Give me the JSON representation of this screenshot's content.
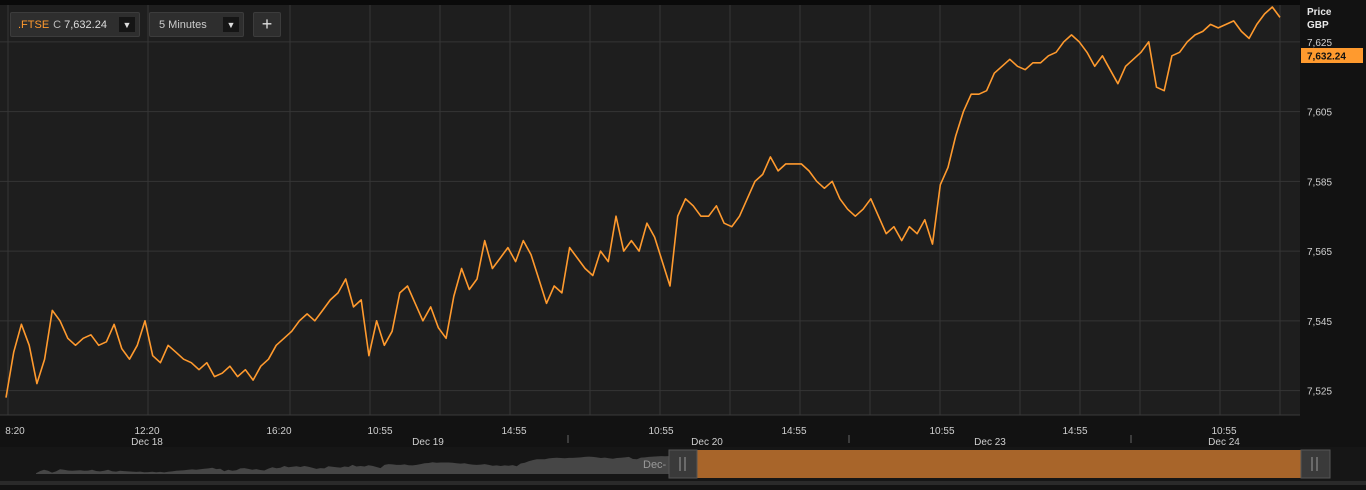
{
  "toolbar": {
    "symbol": ".FTSE",
    "close_prefix": "C",
    "close_value": "7,632.24",
    "interval": "5 Minutes",
    "add_label": "+"
  },
  "price_axis": {
    "label": "Price",
    "currency": "GBP",
    "current_value": "7,632.24"
  },
  "navigator": {
    "left_label": "Dec-"
  },
  "colors": {
    "line": "#ff9a2e",
    "background": "#1e1e1e",
    "grid": "#363636",
    "badge": "#ff9a2e",
    "navigator_fill": "#a8652a"
  },
  "chart_data": {
    "type": "line",
    "series": [
      {
        "values": [
          7523,
          7536,
          7544,
          7538,
          7527,
          7534,
          7548,
          7545,
          7540,
          7538,
          7540,
          7541,
          7538,
          7539,
          7544,
          7537,
          7534,
          7538,
          7545,
          7535,
          7533,
          7538,
          7536,
          7534,
          7533,
          7531,
          7533,
          7529,
          7530,
          7532,
          7529,
          7531,
          7528,
          7532,
          7534,
          7538,
          7540,
          7542,
          7545,
          7547,
          7545,
          7548,
          7551,
          7553,
          7557,
          7549,
          7551,
          7535,
          7545,
          7538,
          7542,
          7553,
          7555,
          7550,
          7545,
          7549,
          7543,
          7540,
          7552,
          7560,
          7554,
          7557,
          7568,
          7560,
          7563,
          7566,
          7562,
          7568,
          7564,
          7557,
          7550,
          7555,
          7553,
          7566,
          7563,
          7560,
          7558,
          7565,
          7562,
          7575,
          7565,
          7568,
          7565,
          7573,
          7569,
          7562,
          7555,
          7575,
          7580,
          7578,
          7575,
          7575,
          7578,
          7573,
          7572,
          7575,
          7580,
          7585,
          7587,
          7592,
          7588,
          7590,
          7590,
          7590,
          7588,
          7585,
          7583,
          7585,
          7580,
          7577,
          7575,
          7577,
          7580,
          7575,
          7570,
          7572,
          7568,
          7572,
          7570,
          7574,
          7567,
          7584,
          7589,
          7598,
          7605,
          7610,
          7610,
          7611,
          7616,
          7618,
          7620,
          7618,
          7617,
          7619,
          7619,
          7621,
          7622,
          7625,
          7627,
          7625,
          7622,
          7618,
          7621,
          7617,
          7613,
          7618,
          7620,
          7622,
          7625,
          7612,
          7611,
          7621,
          7622,
          7625,
          7627,
          7628,
          7630,
          7629,
          7630,
          7631,
          7628,
          7626,
          7630,
          7633,
          7635,
          7632
        ]
      }
    ],
    "ylim": [
      7518,
      7637
    ],
    "yticks": [
      "7,525",
      "7,545",
      "7,565",
      "7,585",
      "7,605",
      "7,625"
    ],
    "xticks": [
      {
        "time": "8:20",
        "date": ""
      },
      {
        "time": "12:20",
        "date": "Dec 18"
      },
      {
        "time": "16:20",
        "date": ""
      },
      {
        "time": "10:55",
        "date": ""
      },
      {
        "time": "",
        "date": "Dec 19"
      },
      {
        "time": "14:55",
        "date": ""
      },
      {
        "time": "10:55",
        "date": ""
      },
      {
        "time": "",
        "date": "Dec 20"
      },
      {
        "time": "14:55",
        "date": ""
      },
      {
        "time": "10:55",
        "date": ""
      },
      {
        "time": "",
        "date": "Dec 23"
      },
      {
        "time": "14:55",
        "date": ""
      },
      {
        "time": "10:55",
        "date": "Dec 24"
      }
    ],
    "grid": true
  }
}
